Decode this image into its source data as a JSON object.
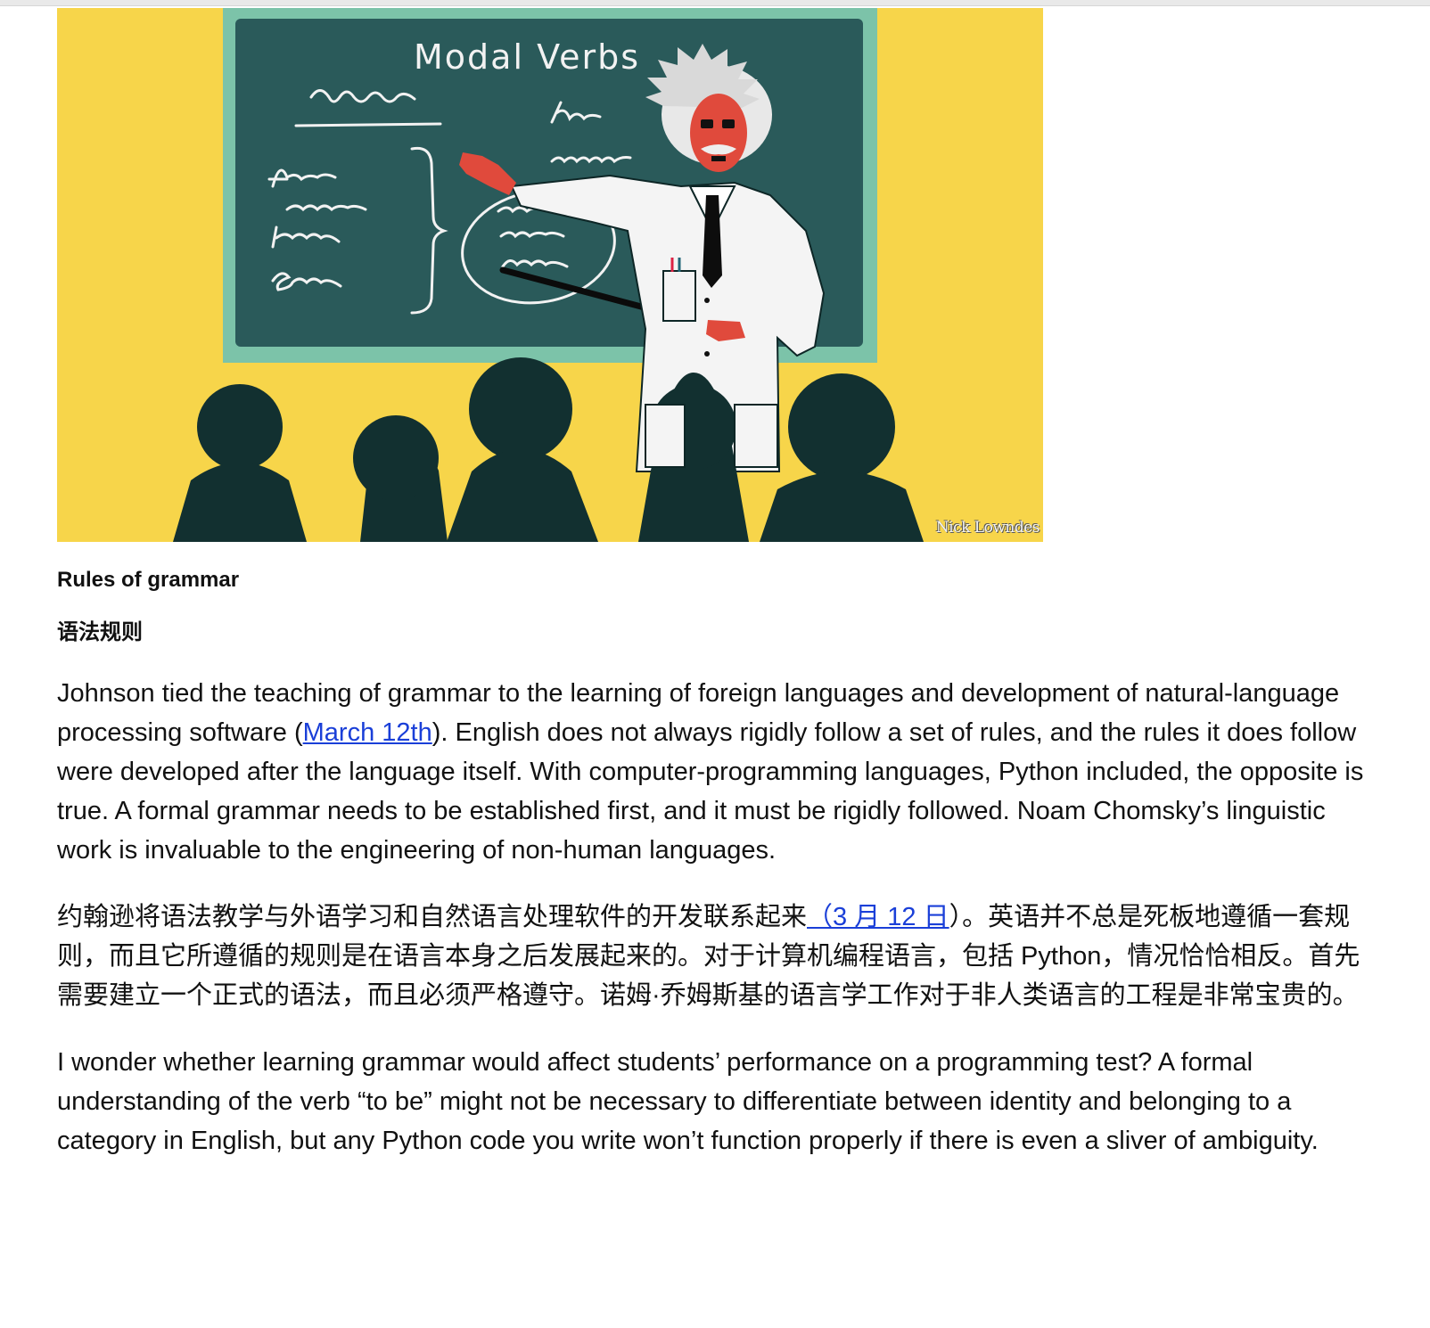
{
  "figure": {
    "board_title": "Modal Verbs",
    "credit": "Nick Lowndes"
  },
  "captions": {
    "english": "Rules of grammar",
    "chinese": "语法规则"
  },
  "paragraphs": {
    "p1_before": "Johnson tied the teaching of grammar to the learning of foreign languages and development of natural-language processing software (",
    "p1_link": "March 12th",
    "p1_after": "). English does not always rigidly follow a set of rules, and the rules it does follow were developed after the language itself. With computer-programming languages, Python included, the opposite is true. A formal grammar needs to be established first, and it must be rigidly followed. Noam Chomsky’s linguistic work is invaluable to the engineering of non-human languages.",
    "p2_before": "约翰逊将语法教学与外语学习和自然语言处理软件的开发联系起来",
    "p2_link": "（3 月 12 日",
    "p2_after": "）。英语并不总是死板地遵循一套规则，而且它所遵循的规则是在语言本身之后发展起来的。对于计算机编程语言，包括 Python，情况恰恰相反。首先需要建立一个正式的语法，而且必须严格遵守。诺姆·乔姆斯基的语言学工作对于非人类语言的工程是非常宝贵的。",
    "p3": "I wonder whether learning grammar would affect students’ performance on a programming test? A formal understanding of the verb “to be” might not be necessary to differentiate between identity and belonging to a category in English, but any Python code you write won’t function properly if there is even a sliver of ambiguity."
  },
  "colors": {
    "link": "#1a3fd8",
    "background_yellow": "#f7d54a",
    "board": "#2a5a5a"
  }
}
